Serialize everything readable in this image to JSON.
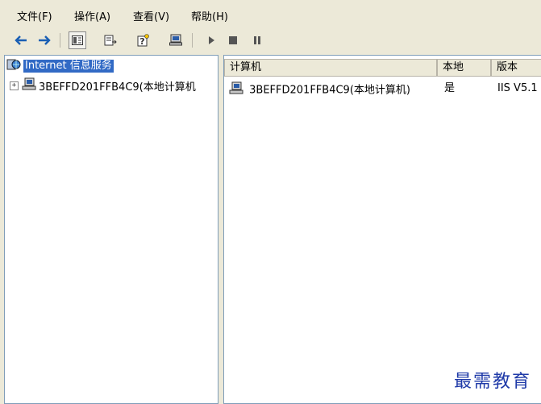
{
  "menubar": {
    "file": "文件(F)",
    "action": "操作(A)",
    "view": "查看(V)",
    "help": "帮助(H)"
  },
  "toolbar": {
    "icons": [
      "back-arrow-icon",
      "forward-arrow-icon",
      "show-hide-tree-icon",
      "export-list-icon",
      "help-icon",
      "computer-icon",
      "play-icon",
      "stop-icon",
      "pause-icon"
    ]
  },
  "tree": {
    "root_label": "Internet 信息服务",
    "child_label": "3BEFFD201FFB4C9(本地计算机"
  },
  "list": {
    "columns": [
      "计算机",
      "本地",
      "版本"
    ],
    "rows": [
      {
        "computer": "3BEFFD201FFB4C9(本地计算机)",
        "local": "是",
        "version": "IIS V5.1"
      }
    ]
  },
  "watermark": "最需教育",
  "colors": {
    "selection": "#316ac5",
    "window_bg": "#ece9d8",
    "watermark": "#1f3aa8"
  }
}
